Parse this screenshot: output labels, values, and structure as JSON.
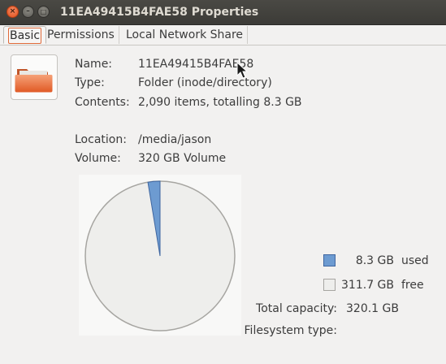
{
  "window": {
    "title": "11EA49415B4FAE58 Properties",
    "close_glyph": "×",
    "min_glyph": "–",
    "max_glyph": "□"
  },
  "tabs": [
    {
      "label": "Basic",
      "active": true
    },
    {
      "label": "Permissions",
      "active": false
    },
    {
      "label": "Local Network Share",
      "active": false
    }
  ],
  "icon": "folder-icon",
  "info": {
    "name_label": "Name:",
    "name_value": "11EA49415B4FAE58",
    "type_label": "Type:",
    "type_value": "Folder (inode/directory)",
    "contents_label": "Contents:",
    "contents_value": "2,090 items, totalling 8.3 GB",
    "location_label": "Location:",
    "location_value": "/media/jason",
    "volume_label": "Volume:",
    "volume_value": "320 GB Volume"
  },
  "usage": {
    "used_value": "8.3 GB",
    "used_label": "used",
    "free_value": "311.7 GB",
    "free_label": "free",
    "total_label": "Total capacity:",
    "total_value": "320.1 GB",
    "fs_label": "Filesystem type:",
    "used_fraction": 0.026,
    "used_color": "#6d9bd1",
    "free_color": "#eeeeec"
  }
}
